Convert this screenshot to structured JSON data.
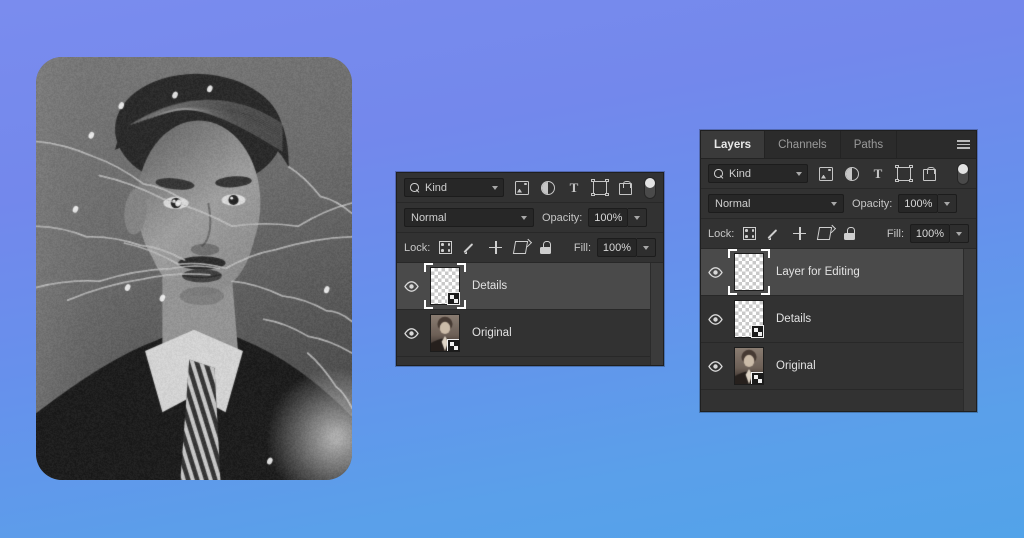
{
  "background": {
    "gradient_top": "#7a8cee",
    "gradient_bottom": "#52a3e9"
  },
  "photo": {
    "name": "restored-portrait",
    "description": "Vintage black and white portrait photograph of a young man in a suit and striped tie, with visible scratches and cracks"
  },
  "panel_small": {
    "filter": {
      "kind_label": "Kind",
      "icons": [
        "image-filter-icon",
        "adjustment-filter-icon",
        "text-filter-icon",
        "shape-filter-icon",
        "smart-object-filter-icon"
      ],
      "toggle": "filter-toggle"
    },
    "blend": {
      "mode": "Normal",
      "opacity_label": "Opacity:",
      "opacity_value": "100%"
    },
    "lock": {
      "label": "Lock:",
      "icons": [
        "lock-transparent-pixels-icon",
        "lock-image-pixels-icon",
        "lock-position-icon",
        "lock-artboard-nesting-icon",
        "lock-all-icon"
      ],
      "fill_label": "Fill:",
      "fill_value": "100%"
    },
    "layers": [
      {
        "name": "Details",
        "visible": true,
        "selected": true,
        "thumb": "checker",
        "smart_object": true
      },
      {
        "name": "Original",
        "visible": true,
        "selected": false,
        "thumb": "photo",
        "smart_object": true
      }
    ]
  },
  "panel_large": {
    "tabs": [
      {
        "label": "Layers",
        "active": true
      },
      {
        "label": "Channels",
        "active": false
      },
      {
        "label": "Paths",
        "active": false
      }
    ],
    "menu_icon": "panel-menu-icon",
    "filter": {
      "kind_label": "Kind",
      "icons": [
        "image-filter-icon",
        "adjustment-filter-icon",
        "text-filter-icon",
        "shape-filter-icon",
        "smart-object-filter-icon"
      ],
      "toggle": "filter-toggle"
    },
    "blend": {
      "mode": "Normal",
      "opacity_label": "Opacity:",
      "opacity_value": "100%"
    },
    "lock": {
      "label": "Lock:",
      "icons": [
        "lock-transparent-pixels-icon",
        "lock-image-pixels-icon",
        "lock-position-icon",
        "lock-artboard-nesting-icon",
        "lock-all-icon"
      ],
      "fill_label": "Fill:",
      "fill_value": "100%"
    },
    "layers": [
      {
        "name": "Layer for Editing",
        "visible": true,
        "selected": true,
        "thumb": "checker",
        "smart_object": false
      },
      {
        "name": "Details",
        "visible": true,
        "selected": false,
        "thumb": "checker",
        "smart_object": true
      },
      {
        "name": "Original",
        "visible": true,
        "selected": false,
        "thumb": "photo",
        "smart_object": true
      }
    ]
  }
}
